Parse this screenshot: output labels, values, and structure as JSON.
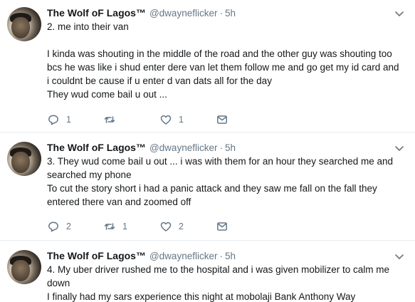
{
  "colors": {
    "text": "#14171a",
    "secondary": "#657786",
    "divider": "#e6ecf0"
  },
  "tweets": [
    {
      "name": "The Wolf oF Lagos™",
      "handle": "@dwayneflicker",
      "separator": "·",
      "time": "5h",
      "paragraphs": [
        "2. me into their van",
        "I kinda was shouting in the middle of the road and the other guy was shouting too bcs he was like i shud enter dere van let them follow me and go get my id card and i couldnt be cause if u enter d van dats all for the day",
        "They wud come bail u out ..."
      ],
      "actions": {
        "replies": "1",
        "retweets": "",
        "likes": "1"
      },
      "icons": [
        "reply-icon",
        "retweet-icon",
        "like-icon",
        "message-icon",
        "chevron-down-icon"
      ]
    },
    {
      "name": "The Wolf oF Lagos™",
      "handle": "@dwayneflicker",
      "separator": "·",
      "time": "5h",
      "paragraphs": [
        "3. They wud come bail u out ... i was with them for an hour they searched me and searched my phone",
        "To cut the story short i had a panic attack and they saw me fall on the fall they entered there van and zoomed off"
      ],
      "actions": {
        "replies": "2",
        "retweets": "1",
        "likes": "2"
      },
      "icons": [
        "reply-icon",
        "retweet-icon",
        "like-icon",
        "message-icon",
        "chevron-down-icon"
      ]
    },
    {
      "name": "The Wolf oF Lagos™",
      "handle": "@dwayneflicker",
      "separator": "·",
      "time": "5h",
      "paragraphs": [
        "4. My uber driver rushed me to the hospital and i was given mobilizer to calm me down",
        "I finally had my sars experience this night at mobolaji Bank Anthony Way"
      ],
      "icons": [
        "chevron-down-icon"
      ]
    }
  ]
}
